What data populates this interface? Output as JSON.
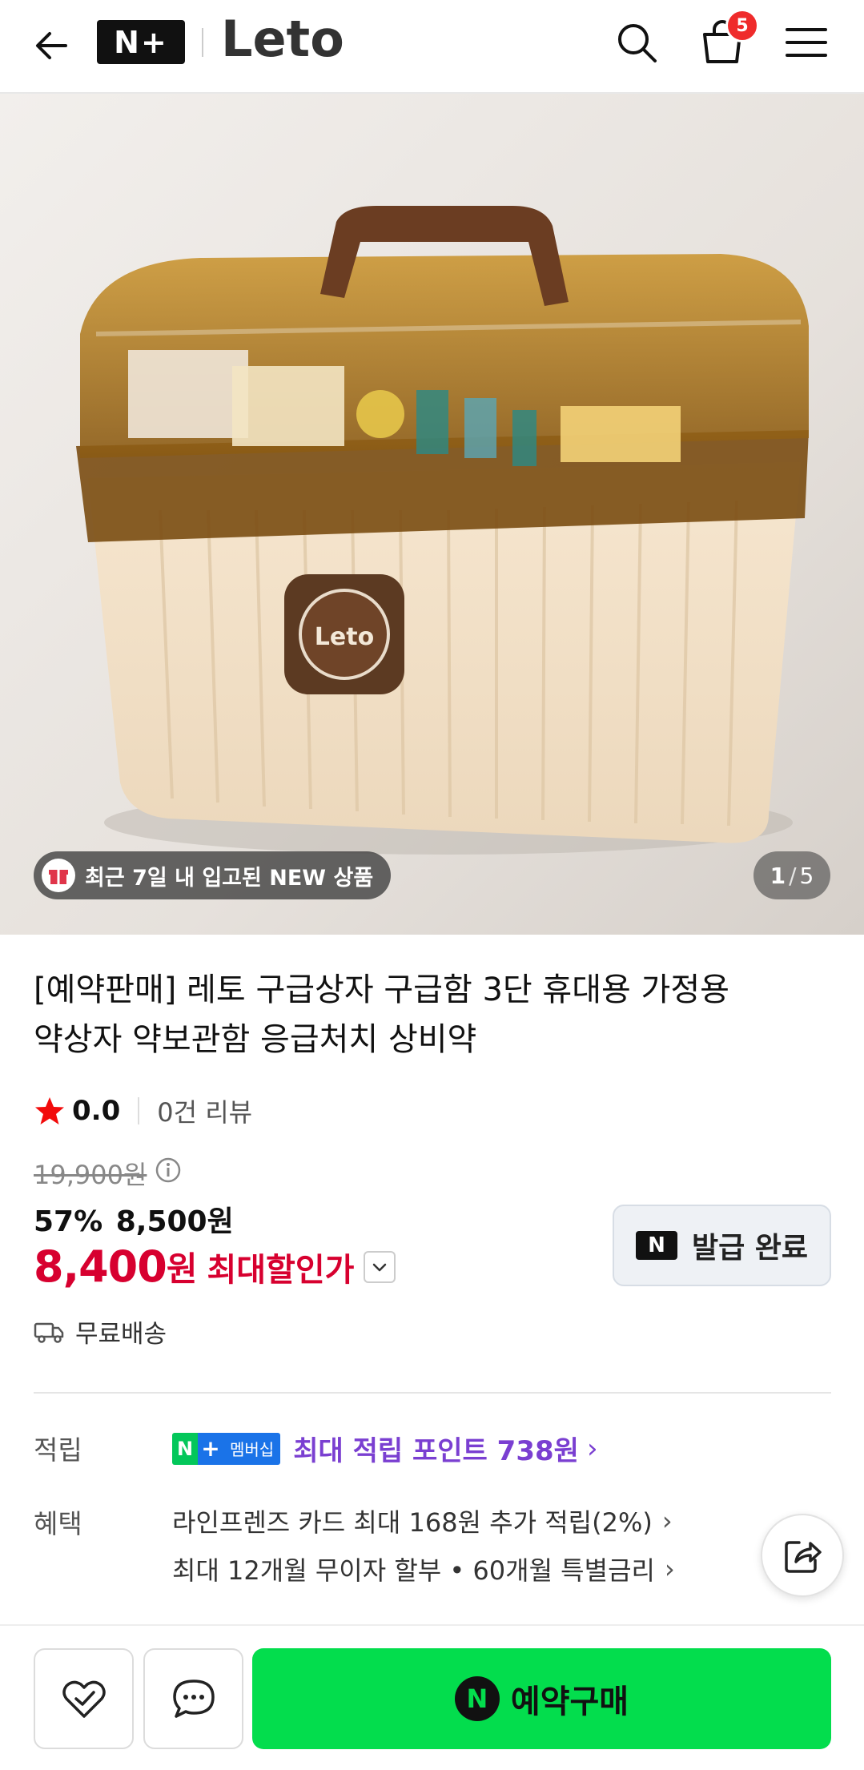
{
  "header": {
    "nplus_logo": "N+",
    "brand": "Leto",
    "cart_count": "5"
  },
  "hero": {
    "new_badge": "최근 7일 내 입고된 NEW 상품",
    "pager_current": "1",
    "pager_sep": "/",
    "pager_total": "5",
    "box_logo": "Leto"
  },
  "product": {
    "title_line1": "[예약판매] 레토 구급상자 구급함 3단 휴대용 가정용",
    "title_line2": "약상자 약보관함 응급처치 상비약",
    "rating": "0.0",
    "review_count": "0건 리뷰",
    "original_price": "19,900원",
    "discount_percent": "57%",
    "sale_price": "8,500원",
    "best_price_amount": "8,400",
    "best_price_unit": "원",
    "best_price_label": "최대할인가",
    "coupon_icon": "N",
    "coupon_label": "발급 완료",
    "shipping": "무료배송"
  },
  "points": {
    "label": "적립",
    "badge_n": "N",
    "badge_plus": "+",
    "badge_membership": "멤버십",
    "text": "최대 적립 포인트 738원",
    "arrow": "›"
  },
  "benefits": {
    "label": "혜택",
    "items": [
      "라인프렌즈 카드 최대 168원 추가 적립(2%)",
      "최대 12개월 무이자 할부 • 60개월 특별금리"
    ],
    "arrow": "›"
  },
  "bottom_bar": {
    "buy_icon": "N",
    "buy_label": "예약구매"
  },
  "colors": {
    "accent_red": "#d7002f",
    "naver_green": "#03dd4d",
    "points_purple": "#7a3fd1",
    "badge_red": "#ef2b2b"
  }
}
